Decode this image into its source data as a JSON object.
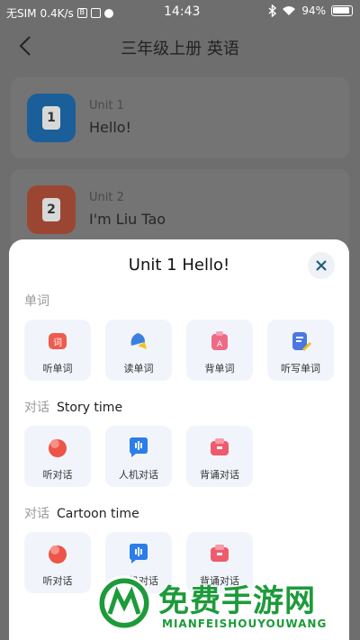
{
  "status_bar": {
    "carrier": "无SIM",
    "speed": "0.4K/s",
    "time": "14:43",
    "battery": "94%"
  },
  "nav": {
    "title": "三年级上册 英语"
  },
  "units": [
    {
      "number": "1",
      "name": "Unit 1",
      "title": "Hello!",
      "color": "#1f77c9"
    },
    {
      "number": "2",
      "name": "Unit 2",
      "title": "I'm Liu Tao",
      "color": "#c2482b"
    }
  ],
  "sheet": {
    "title": "Unit 1 Hello!",
    "sections": [
      {
        "label": "单词",
        "sub": "",
        "items": [
          {
            "label": "听单词",
            "icon": "word-listen-icon"
          },
          {
            "label": "读单词",
            "icon": "word-read-icon"
          },
          {
            "label": "背单词",
            "icon": "word-memorize-icon"
          },
          {
            "label": "听写单词",
            "icon": "word-dictation-icon"
          }
        ]
      },
      {
        "label": "对话",
        "sub": "Story time",
        "items": [
          {
            "label": "听对话",
            "icon": "dialog-listen-icon"
          },
          {
            "label": "人机对话",
            "icon": "dialog-ai-icon"
          },
          {
            "label": "背诵对话",
            "icon": "dialog-recite-icon"
          }
        ]
      },
      {
        "label": "对话",
        "sub": "Cartoon time",
        "items": [
          {
            "label": "听对话",
            "icon": "dialog-listen-icon"
          },
          {
            "label": "人机对话",
            "icon": "dialog-ai-icon"
          },
          {
            "label": "背诵对话",
            "icon": "dialog-recite-icon"
          }
        ]
      }
    ]
  },
  "watermark": {
    "text": "免费手游网",
    "sub": "MIANFEISHOUYOUWANG"
  },
  "colors": {
    "accent": "#1f77c9",
    "red": "#e8504a",
    "blue": "#2b7de9",
    "green": "#1d9a3a"
  }
}
